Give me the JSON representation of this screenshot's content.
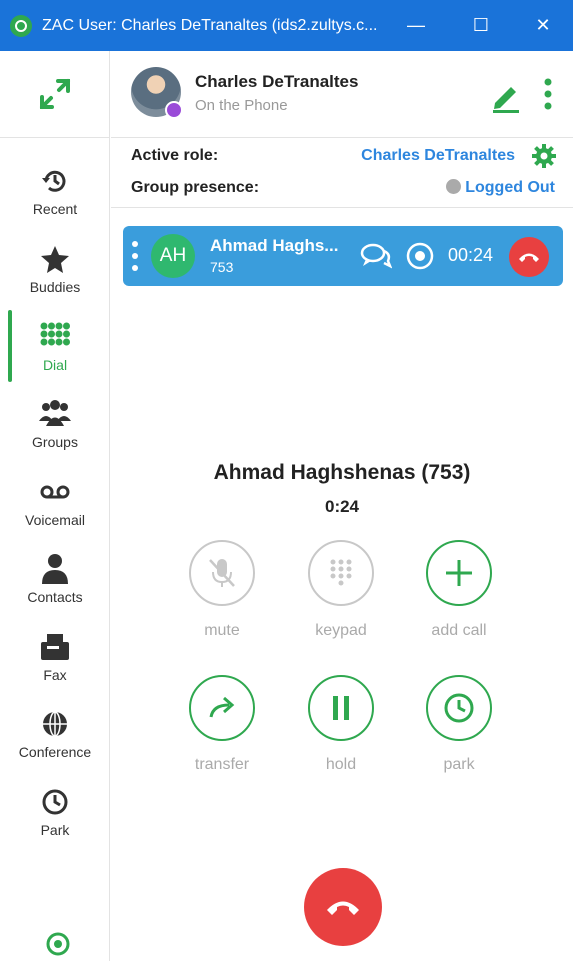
{
  "window": {
    "title": "ZAC User: Charles DeTranaltes (ids2.zultys.c...",
    "minimize": "—",
    "maximize": "☐",
    "close": "✕"
  },
  "user": {
    "name": "Charles DeTranaltes",
    "status": "On the Phone"
  },
  "roles": {
    "active_role_label": "Active role:",
    "active_role_value": "Charles DeTranaltes",
    "group_presence_label": "Group presence:",
    "group_presence_value": "Logged Out"
  },
  "sidebar": {
    "items": [
      {
        "label": "Recent",
        "icon": "history-icon"
      },
      {
        "label": "Buddies",
        "icon": "star-icon"
      },
      {
        "label": "Dial",
        "icon": "dialpad-icon",
        "active": true
      },
      {
        "label": "Groups",
        "icon": "people-icon"
      },
      {
        "label": "Voicemail",
        "icon": "voicemail-icon"
      },
      {
        "label": "Contacts",
        "icon": "person-icon"
      },
      {
        "label": "Fax",
        "icon": "fax-icon"
      },
      {
        "label": "Conference",
        "icon": "globe-icon"
      },
      {
        "label": "Park",
        "icon": "park-clock-icon"
      }
    ]
  },
  "call_card": {
    "initials": "AH",
    "name": "Ahmad Haghs...",
    "extension": "753",
    "timer": "00:24"
  },
  "call": {
    "name": "Ahmad Haghshenas (753)",
    "duration": "0:24",
    "controls": {
      "mute": "mute",
      "keypad": "keypad",
      "add_call": "add call",
      "transfer": "transfer",
      "hold": "hold",
      "park": "park"
    }
  },
  "colors": {
    "titlebar": "#1a73d9",
    "accent_green": "#2fa84f",
    "call_card": "#3a9ddc",
    "hangup_red": "#e84040",
    "link_blue": "#2e86de"
  }
}
